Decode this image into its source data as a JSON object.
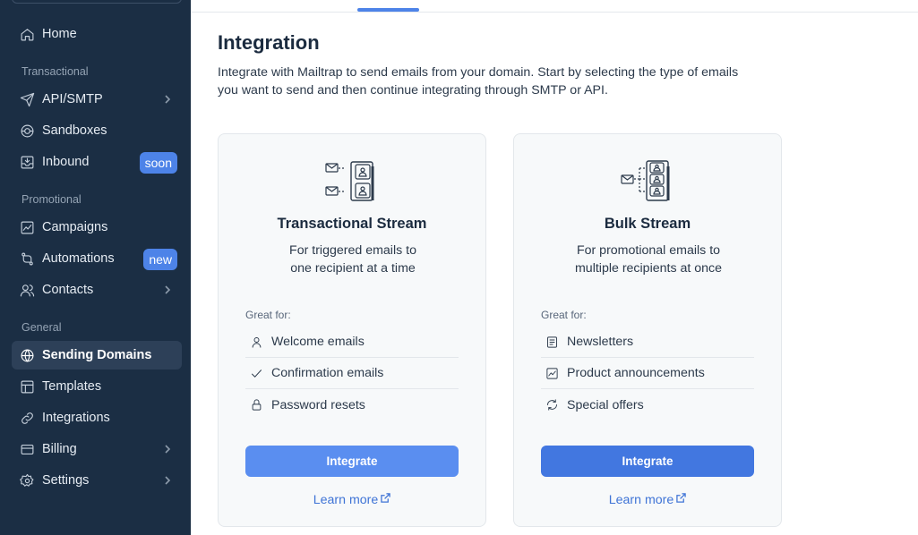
{
  "sidebar": {
    "items": [
      {
        "label": "Home",
        "icon": "home-icon"
      },
      {
        "label": "API/SMTP",
        "icon": "send-icon"
      },
      {
        "label": "Sandboxes",
        "icon": "sandbox-icon"
      },
      {
        "label": "Inbound",
        "icon": "inbox-icon",
        "badge": "soon"
      },
      {
        "label": "Campaigns",
        "icon": "chart-line-icon"
      },
      {
        "label": "Automations",
        "icon": "automation-icon",
        "badge": "new"
      },
      {
        "label": "Contacts",
        "icon": "contacts-icon"
      },
      {
        "label": "Sending Domains",
        "icon": "globe-icon",
        "active": true
      },
      {
        "label": "Templates",
        "icon": "template-icon"
      },
      {
        "label": "Integrations",
        "icon": "link-icon"
      },
      {
        "label": "Billing",
        "icon": "credit-card-icon"
      },
      {
        "label": "Settings",
        "icon": "gear-icon"
      }
    ],
    "sections": {
      "transactional": "Transactional",
      "promotional": "Promotional",
      "general": "General"
    }
  },
  "main": {
    "title": "Integration",
    "description": "Integrate with Mailtrap to send emails from your domain. Start by selecting the type of emails you want to send and then continue integrating through SMTP or API."
  },
  "cards": [
    {
      "title": "Transactional Stream",
      "desc_line1": "For triggered emails to",
      "desc_line2": "one recipient at a time",
      "great_for": "Great for:",
      "features": [
        {
          "label": "Welcome emails",
          "icon": "user-icon"
        },
        {
          "label": "Confirmation emails",
          "icon": "check-icon"
        },
        {
          "label": "Password resets",
          "icon": "lock-icon"
        }
      ],
      "button": "Integrate",
      "learn_more": "Learn more"
    },
    {
      "title": "Bulk Stream",
      "desc_line1": "For promotional emails to",
      "desc_line2": "multiple recipients at once",
      "great_for": "Great for:",
      "features": [
        {
          "label": "Newsletters",
          "icon": "newsletter-icon"
        },
        {
          "label": "Product announcements",
          "icon": "chart-up-icon"
        },
        {
          "label": "Special offers",
          "icon": "refresh-icon"
        }
      ],
      "button": "Integrate",
      "learn_more": "Learn more"
    }
  ],
  "colors": {
    "sidebar_bg": "#1b2e44",
    "accent": "#4d83e8",
    "card_bg": "#f7f9fa"
  }
}
